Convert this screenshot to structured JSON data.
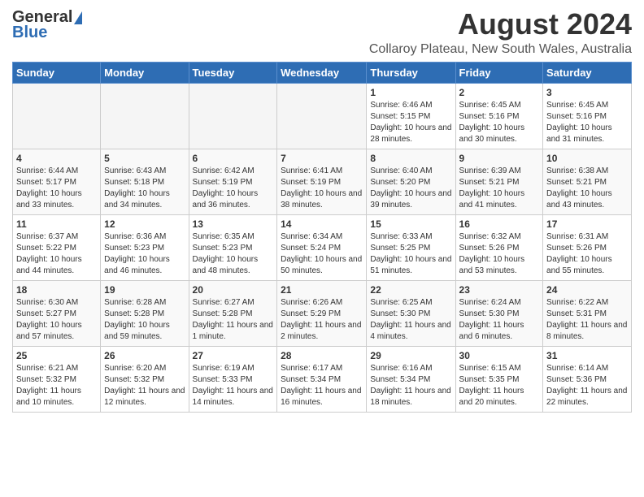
{
  "header": {
    "logo_line1": "General",
    "logo_line2": "Blue",
    "main_title": "August 2024",
    "subtitle": "Collaroy Plateau, New South Wales, Australia"
  },
  "days_of_week": [
    "Sunday",
    "Monday",
    "Tuesday",
    "Wednesday",
    "Thursday",
    "Friday",
    "Saturday"
  ],
  "weeks": [
    [
      {
        "day": "",
        "empty": true
      },
      {
        "day": "",
        "empty": true
      },
      {
        "day": "",
        "empty": true
      },
      {
        "day": "",
        "empty": true
      },
      {
        "day": "1",
        "sunrise": "6:46 AM",
        "sunset": "5:15 PM",
        "daylight": "10 hours and 28 minutes."
      },
      {
        "day": "2",
        "sunrise": "6:45 AM",
        "sunset": "5:16 PM",
        "daylight": "10 hours and 30 minutes."
      },
      {
        "day": "3",
        "sunrise": "6:45 AM",
        "sunset": "5:16 PM",
        "daylight": "10 hours and 31 minutes."
      }
    ],
    [
      {
        "day": "4",
        "sunrise": "6:44 AM",
        "sunset": "5:17 PM",
        "daylight": "10 hours and 33 minutes."
      },
      {
        "day": "5",
        "sunrise": "6:43 AM",
        "sunset": "5:18 PM",
        "daylight": "10 hours and 34 minutes."
      },
      {
        "day": "6",
        "sunrise": "6:42 AM",
        "sunset": "5:19 PM",
        "daylight": "10 hours and 36 minutes."
      },
      {
        "day": "7",
        "sunrise": "6:41 AM",
        "sunset": "5:19 PM",
        "daylight": "10 hours and 38 minutes."
      },
      {
        "day": "8",
        "sunrise": "6:40 AM",
        "sunset": "5:20 PM",
        "daylight": "10 hours and 39 minutes."
      },
      {
        "day": "9",
        "sunrise": "6:39 AM",
        "sunset": "5:21 PM",
        "daylight": "10 hours and 41 minutes."
      },
      {
        "day": "10",
        "sunrise": "6:38 AM",
        "sunset": "5:21 PM",
        "daylight": "10 hours and 43 minutes."
      }
    ],
    [
      {
        "day": "11",
        "sunrise": "6:37 AM",
        "sunset": "5:22 PM",
        "daylight": "10 hours and 44 minutes."
      },
      {
        "day": "12",
        "sunrise": "6:36 AM",
        "sunset": "5:23 PM",
        "daylight": "10 hours and 46 minutes."
      },
      {
        "day": "13",
        "sunrise": "6:35 AM",
        "sunset": "5:23 PM",
        "daylight": "10 hours and 48 minutes."
      },
      {
        "day": "14",
        "sunrise": "6:34 AM",
        "sunset": "5:24 PM",
        "daylight": "10 hours and 50 minutes."
      },
      {
        "day": "15",
        "sunrise": "6:33 AM",
        "sunset": "5:25 PM",
        "daylight": "10 hours and 51 minutes."
      },
      {
        "day": "16",
        "sunrise": "6:32 AM",
        "sunset": "5:26 PM",
        "daylight": "10 hours and 53 minutes."
      },
      {
        "day": "17",
        "sunrise": "6:31 AM",
        "sunset": "5:26 PM",
        "daylight": "10 hours and 55 minutes."
      }
    ],
    [
      {
        "day": "18",
        "sunrise": "6:30 AM",
        "sunset": "5:27 PM",
        "daylight": "10 hours and 57 minutes."
      },
      {
        "day": "19",
        "sunrise": "6:28 AM",
        "sunset": "5:28 PM",
        "daylight": "10 hours and 59 minutes."
      },
      {
        "day": "20",
        "sunrise": "6:27 AM",
        "sunset": "5:28 PM",
        "daylight": "11 hours and 1 minute."
      },
      {
        "day": "21",
        "sunrise": "6:26 AM",
        "sunset": "5:29 PM",
        "daylight": "11 hours and 2 minutes."
      },
      {
        "day": "22",
        "sunrise": "6:25 AM",
        "sunset": "5:30 PM",
        "daylight": "11 hours and 4 minutes."
      },
      {
        "day": "23",
        "sunrise": "6:24 AM",
        "sunset": "5:30 PM",
        "daylight": "11 hours and 6 minutes."
      },
      {
        "day": "24",
        "sunrise": "6:22 AM",
        "sunset": "5:31 PM",
        "daylight": "11 hours and 8 minutes."
      }
    ],
    [
      {
        "day": "25",
        "sunrise": "6:21 AM",
        "sunset": "5:32 PM",
        "daylight": "11 hours and 10 minutes."
      },
      {
        "day": "26",
        "sunrise": "6:20 AM",
        "sunset": "5:32 PM",
        "daylight": "11 hours and 12 minutes."
      },
      {
        "day": "27",
        "sunrise": "6:19 AM",
        "sunset": "5:33 PM",
        "daylight": "11 hours and 14 minutes."
      },
      {
        "day": "28",
        "sunrise": "6:17 AM",
        "sunset": "5:34 PM",
        "daylight": "11 hours and 16 minutes."
      },
      {
        "day": "29",
        "sunrise": "6:16 AM",
        "sunset": "5:34 PM",
        "daylight": "11 hours and 18 minutes."
      },
      {
        "day": "30",
        "sunrise": "6:15 AM",
        "sunset": "5:35 PM",
        "daylight": "11 hours and 20 minutes."
      },
      {
        "day": "31",
        "sunrise": "6:14 AM",
        "sunset": "5:36 PM",
        "daylight": "11 hours and 22 minutes."
      }
    ]
  ],
  "labels": {
    "sunrise": "Sunrise:",
    "sunset": "Sunset:",
    "daylight": "Daylight:"
  }
}
